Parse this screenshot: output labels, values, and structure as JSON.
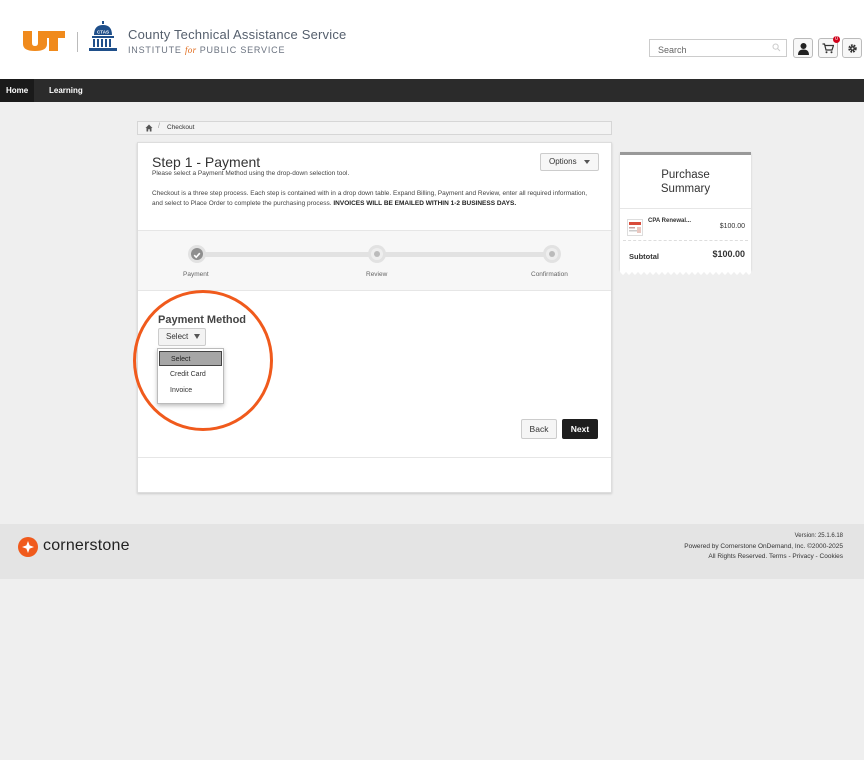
{
  "header": {
    "org_title": "County Technical Assistance Service",
    "org_sub_pre": "INSTITUTE ",
    "org_sub_for": "for",
    "org_sub_post": " PUBLIC SERVICE",
    "ctas_badge": "CTAS",
    "search_placeholder": "Search",
    "cart_count": "0",
    "colors": {
      "ut_orange": "#f08a1c",
      "ctas_blue": "#1f4f8a"
    }
  },
  "nav": {
    "items": [
      {
        "label": "Home",
        "active": true
      },
      {
        "label": "Learning",
        "active": false
      }
    ]
  },
  "breadcrumb": {
    "items": [
      "Checkout"
    ]
  },
  "checkout": {
    "title": "Step 1 - Payment",
    "subtitle": "Please select a Payment Method using the drop-down selection tool.",
    "description": "Checkout is a three step process. Each step is contained with in a drop down table. Expand Billing, Payment and Review, enter all required information, and select to Place Order to complete the purchasing process. ",
    "description_bold": "INVOICES WILL BE EMAILED WITHIN 1-2 BUSINESS DAYS.",
    "options_label": "Options",
    "steps": [
      "Payment",
      "Review",
      "Confirmation"
    ],
    "payment_method_label": "Payment Method",
    "select_label": "Select",
    "dropdown_options": [
      "Select",
      "Credit Card",
      "Invoice"
    ],
    "back_label": "Back",
    "next_label": "Next"
  },
  "summary": {
    "title_line1": "Purchase",
    "title_line2": "Summary",
    "item_name": "CPA Renewal...",
    "item_price": "$100.00",
    "subtotal_label": "Subtotal",
    "subtotal_value": "$100.00"
  },
  "footer": {
    "brand": "cornerstone",
    "version": "Version: 25.1.6.18",
    "powered": "Powered by Cornerstone OnDemand, Inc. ©2000-2025",
    "rights": "All Rights Reserved.",
    "terms": "Terms",
    "privacy": "Privacy",
    "cookies": "Cookies",
    "colors": {
      "logo": "#f05a1c"
    }
  }
}
